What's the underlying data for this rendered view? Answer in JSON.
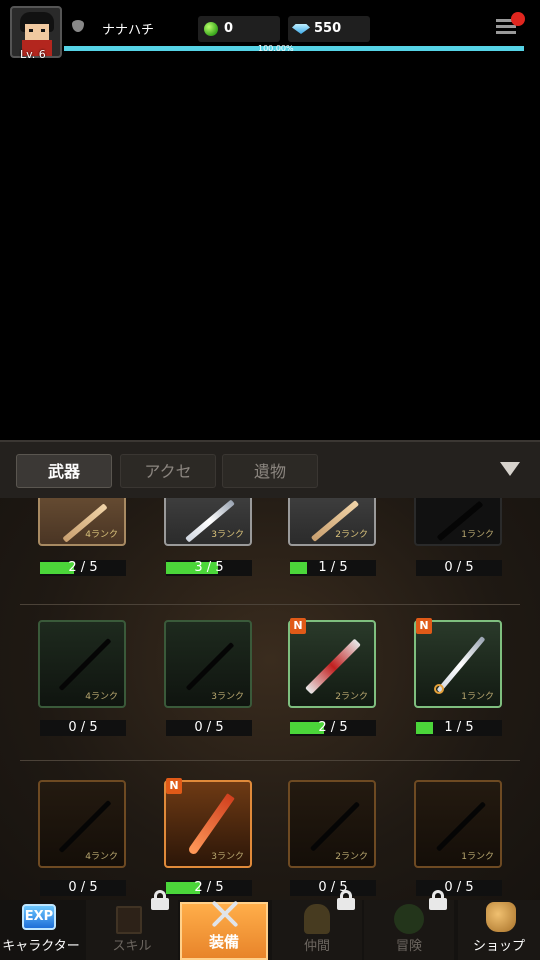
{
  "hud": {
    "level": "Lv. 6",
    "player_name": "ナナハチ",
    "gems": "0",
    "diamonds": "550",
    "xp_percent_text": "100.00%",
    "xp_fraction": 1.0
  },
  "tabs": [
    {
      "label": "武器",
      "active": true
    },
    {
      "label": "アクセ",
      "active": false
    },
    {
      "label": "遺物",
      "active": false
    }
  ],
  "weapons": {
    "row1": [
      {
        "rank": "4ランク",
        "count": "2 / 5",
        "progress": 0.4,
        "owned": true,
        "style": "bronze",
        "new": false
      },
      {
        "rank": "3ランク",
        "count": "3 / 5",
        "progress": 0.6,
        "owned": true,
        "style": "steel",
        "new": false
      },
      {
        "rank": "2ランク",
        "count": "1 / 5",
        "progress": 0.2,
        "owned": true,
        "style": "wood",
        "new": false
      },
      {
        "rank": "1ランク",
        "count": "0 / 5",
        "progress": 0,
        "owned": false,
        "style": "gray",
        "new": false
      }
    ],
    "row2": [
      {
        "rank": "4ランク",
        "count": "0 / 5",
        "progress": 0,
        "owned": false,
        "new": false
      },
      {
        "rank": "3ランク",
        "count": "0 / 5",
        "progress": 0,
        "owned": false,
        "new": false
      },
      {
        "rank": "2ランク",
        "count": "2 / 5",
        "progress": 0.4,
        "owned": true,
        "new": true,
        "badge": "N"
      },
      {
        "rank": "1ランク",
        "count": "1 / 5",
        "progress": 0.2,
        "owned": true,
        "new": true,
        "badge": "N"
      }
    ],
    "row3": [
      {
        "rank": "4ランク",
        "count": "0 / 5",
        "progress": 0,
        "owned": false,
        "new": false
      },
      {
        "rank": "3ランク",
        "count": "2 / 5",
        "progress": 0.4,
        "owned": true,
        "new": true,
        "badge": "N"
      },
      {
        "rank": "2ランク",
        "count": "0 / 5",
        "progress": 0,
        "owned": false,
        "new": false
      },
      {
        "rank": "1ランク",
        "count": "0 / 5",
        "progress": 0,
        "owned": false,
        "new": false
      }
    ]
  },
  "nav": [
    {
      "label": "キャラクター",
      "icon": "exp-icon",
      "icon_text": "EXP",
      "active": false,
      "locked": false
    },
    {
      "label": "スキル",
      "icon": "book-icon",
      "active": false,
      "locked": true
    },
    {
      "label": "装備",
      "icon": "swords-icon",
      "active": true,
      "locked": false
    },
    {
      "label": "仲間",
      "icon": "companion-icon",
      "active": false,
      "locked": true
    },
    {
      "label": "冒険",
      "icon": "tree-icon",
      "active": false,
      "locked": true
    },
    {
      "label": "ショップ",
      "icon": "gold-bag-icon",
      "active": false,
      "locked": false
    }
  ],
  "colors": {
    "xp_bar": "#56d3e6",
    "progress_green": "#4bd63a",
    "nav_active": "#f09a3a",
    "badge_new": "#e05a18",
    "notification": "#e0261f"
  }
}
